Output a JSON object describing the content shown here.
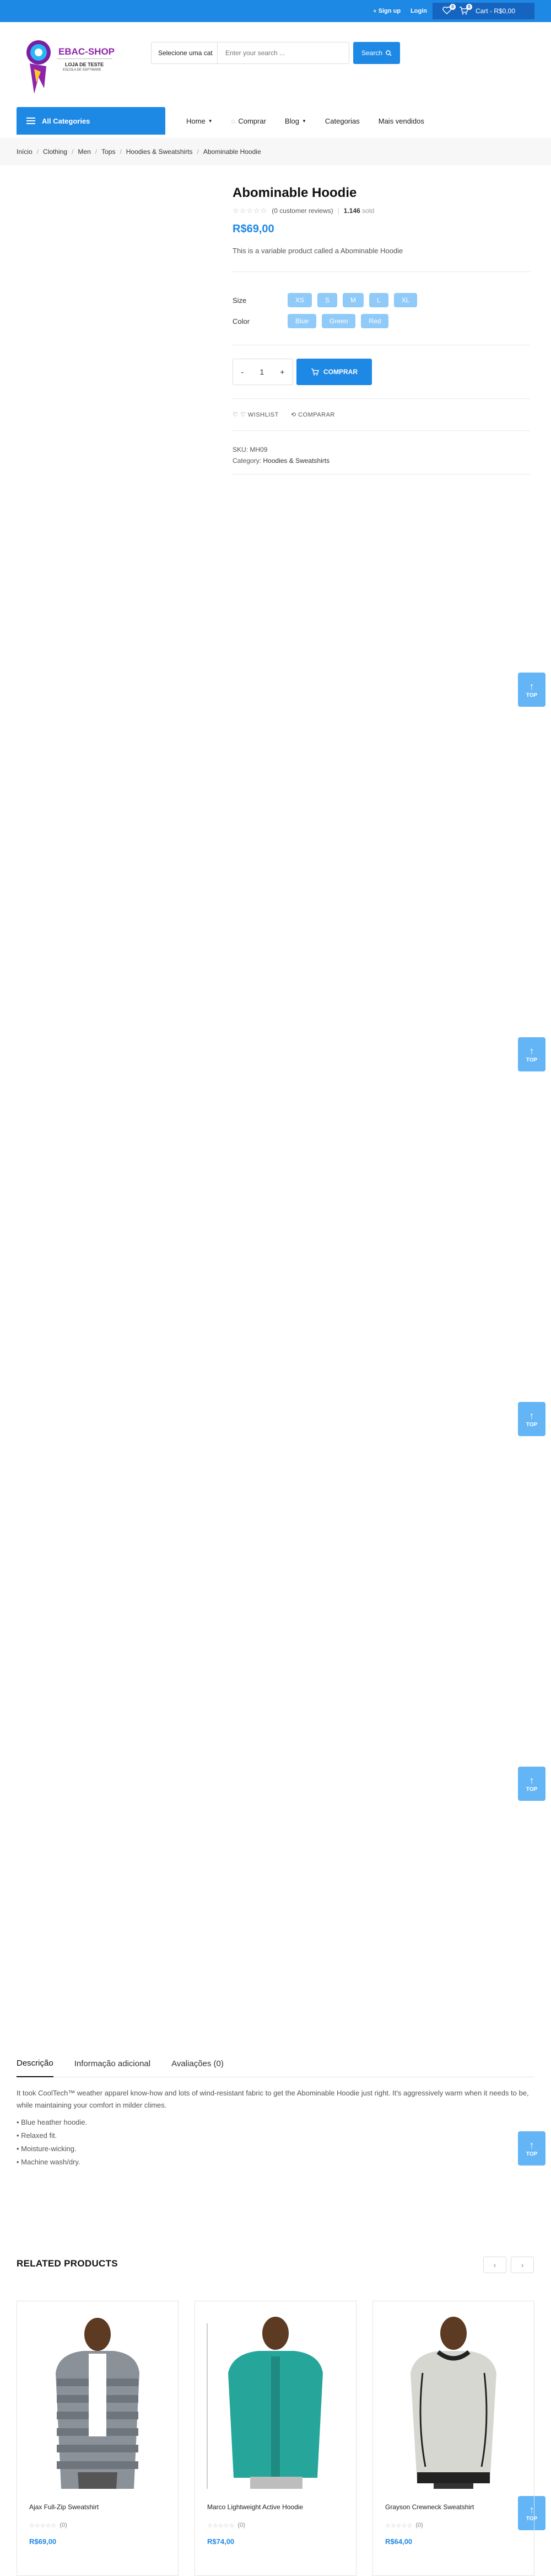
{
  "topbar": {
    "signup": "Sign up",
    "login": "Login",
    "wishlist_count": "0",
    "cart_count": "0",
    "cart_label": "Cart - R$0,00"
  },
  "logo": {
    "name": "EBAC-SHOP",
    "line1": "LOJA DE TESTE",
    "line2": "ESCOLA DE SOFTWARE"
  },
  "search": {
    "category": "Selecione uma cat",
    "placeholder": "Enter your search ...",
    "button": "Search"
  },
  "nav": {
    "all_categories": "All Categories",
    "items": [
      "Home",
      "Comprar",
      "Blog",
      "Categorias",
      "Mais vendidos"
    ]
  },
  "breadcrumb": [
    "Início",
    "Clothing",
    "Men",
    "Tops",
    "Hoodies & Sweatshirts",
    "Abominable Hoodie"
  ],
  "product": {
    "title": "Abominable Hoodie",
    "stars": "☆☆☆☆☆",
    "reviews": "(0 customer reviews)",
    "sold_count": "1.146",
    "sold_label": "sold",
    "price": "R$69,00",
    "description": "This is a variable product called a Abominable Hoodie",
    "size_label": "Size",
    "sizes": [
      "XS",
      "S",
      "M",
      "L",
      "XL"
    ],
    "color_label": "Color",
    "colors": [
      "Blue",
      "Green",
      "Red"
    ],
    "qty_minus": "-",
    "qty": "1",
    "qty_plus": "+",
    "buy_label": "COMPRAR",
    "wishlist_label": "WISHLIST",
    "compare_label": "COMPARAR",
    "sku_label": "SKU:",
    "sku": "MH09",
    "category_label": "Category:",
    "category": "Hoodies & Sweatshirts"
  },
  "to_top_label": "TOP",
  "tabs": [
    "Descrição",
    "Informação adicional",
    "Avaliações (0)"
  ],
  "tab_content": {
    "intro": "It took CoolTech™ weather apparel know-how and lots of wind-resistant fabric to get the Abominable Hoodie just right. It's aggressively warm when it needs to be, while maintaining your comfort in milder climes.",
    "bullets": [
      "• Blue heather hoodie.",
      "• Relaxed fit.",
      "• Moisture-wicking.",
      "• Machine wash/dry."
    ]
  },
  "related": {
    "title": "RELATED PRODUCTS",
    "prev": "‹",
    "next": "›",
    "products": [
      {
        "name": "Ajax Full-Zip Sweatshirt",
        "stars": "☆☆☆☆☆",
        "count": "(0)",
        "price": "R$69,00"
      },
      {
        "name": "Marco Lightweight Active Hoodie",
        "stars": "☆☆☆☆☆",
        "count": "(0)",
        "price": "R$74,00"
      },
      {
        "name": "Grayson Crewneck Sweatshirt",
        "stars": "☆☆☆☆☆",
        "count": "(0)",
        "price": "R$64,00"
      }
    ]
  },
  "colors": {
    "primary": "#1e88e5",
    "cart_bg": "#1565c0",
    "pill": "#90caf9",
    "top_btn": "#64b5f6",
    "logo_purple": "#8e24aa"
  }
}
